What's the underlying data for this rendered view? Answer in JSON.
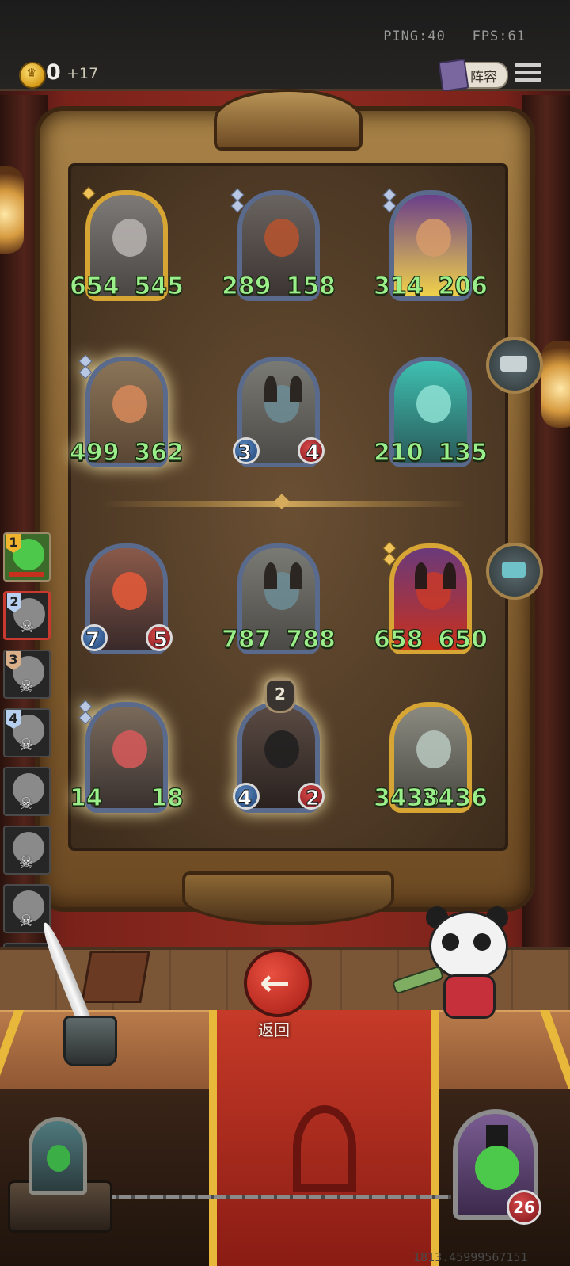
{
  "status": {
    "ping": "PING:40",
    "fps": "FPS:61"
  },
  "currency": {
    "amount": "0",
    "income": "+17"
  },
  "header": {
    "lineup_label": "阵容"
  },
  "board": {
    "minions": [
      {
        "attack": "654",
        "health": "545",
        "frame": "gold"
      },
      {
        "attack": "289",
        "health": "158",
        "frame": "blue"
      },
      {
        "attack": "314",
        "health": "206",
        "frame": "blue"
      },
      {
        "attack": "499",
        "health": "362",
        "frame": "blue"
      },
      {
        "attack": "3",
        "health": "4",
        "frame": "blue"
      },
      {
        "attack": "210",
        "health": "135",
        "frame": "blue"
      },
      {
        "attack": "7",
        "health": "5",
        "frame": "blue"
      },
      {
        "attack": "787",
        "health": "788",
        "frame": "blue"
      },
      {
        "attack": "658",
        "health": "650",
        "frame": "gold"
      },
      {
        "attack": "14",
        "health": "18",
        "frame": "blue"
      },
      {
        "attack": "4",
        "health": "2",
        "frame": "blue",
        "level": "2"
      },
      {
        "attack": "3438",
        "health": "3436",
        "frame": "gold"
      }
    ]
  },
  "players": [
    {
      "rank": "1",
      "status": "active"
    },
    {
      "rank": "2",
      "status": "eliminated",
      "selected": true
    },
    {
      "rank": "3",
      "status": "eliminated"
    },
    {
      "rank": "4",
      "status": "eliminated"
    },
    {
      "status": "eliminated"
    },
    {
      "status": "eliminated"
    },
    {
      "status": "eliminated"
    },
    {
      "status": "eliminated"
    }
  ],
  "controls": {
    "back_label": "返回"
  },
  "hero": {
    "health": "26"
  },
  "debug_text": "1813.45999567151",
  "colors": {
    "stat_green": "#9bef8a",
    "attack_orb": "#1f4275",
    "health_orb": "#7a1418",
    "gold_frame": "#d6a534"
  }
}
